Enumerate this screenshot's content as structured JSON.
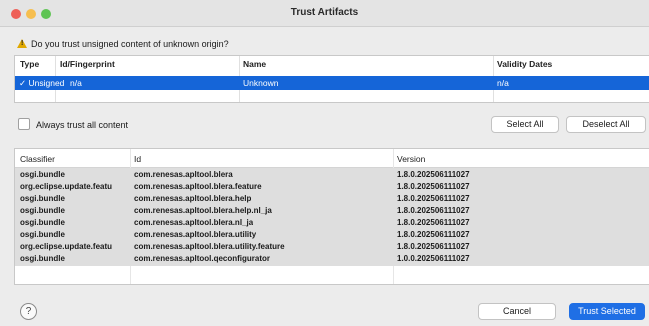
{
  "window": {
    "title": "Trust Artifacts",
    "traffic_lights": [
      "#ee5f57",
      "#f6be4f",
      "#5fc454"
    ]
  },
  "prompt": "Do you trust unsigned content of unknown origin?",
  "trust_table": {
    "headers": [
      "Type",
      "Id/Fingerprint",
      "Name",
      "Validity Dates"
    ],
    "selected_row": {
      "type": "Unsigned",
      "checked": true,
      "fingerprint": "n/a",
      "name": "Unknown",
      "validity": "n/a"
    },
    "selection_color": "#1565d8"
  },
  "always_trust_label": "Always trust all content",
  "select_all_label": "Select All",
  "deselect_all_label": "Deselect All",
  "artifacts_table": {
    "headers": [
      "Classifier",
      "Id",
      "Version"
    ],
    "rows": [
      {
        "classifier": "osgi.bundle",
        "id": "com.renesas.apltool.blera",
        "version": "1.8.0.202506111027"
      },
      {
        "classifier": "org.eclipse.update.featu",
        "id": "com.renesas.apltool.blera.feature",
        "version": "1.8.0.202506111027"
      },
      {
        "classifier": "osgi.bundle",
        "id": "com.renesas.apltool.blera.help",
        "version": "1.8.0.202506111027"
      },
      {
        "classifier": "osgi.bundle",
        "id": "com.renesas.apltool.blera.help.nl_ja",
        "version": "1.8.0.202506111027"
      },
      {
        "classifier": "osgi.bundle",
        "id": "com.renesas.apltool.blera.nl_ja",
        "version": "1.8.0.202506111027"
      },
      {
        "classifier": "osgi.bundle",
        "id": "com.renesas.apltool.blera.utility",
        "version": "1.8.0.202506111027"
      },
      {
        "classifier": "org.eclipse.update.featu",
        "id": "com.renesas.apltool.blera.utility.feature",
        "version": "1.8.0.202506111027"
      },
      {
        "classifier": "osgi.bundle",
        "id": "com.renesas.apltool.qeconfigurator",
        "version": "1.0.0.202506111027"
      }
    ]
  },
  "help_icon": "question-mark-circle-icon",
  "help_glyph": "?",
  "cancel_label": "Cancel",
  "trust_selected_label": "Trust Selected",
  "accent_color": "#1f6fe5"
}
